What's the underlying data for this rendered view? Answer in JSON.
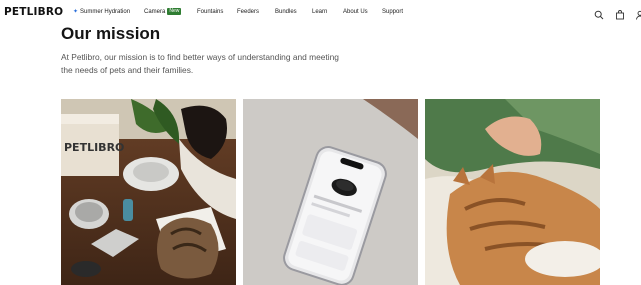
{
  "brand": {
    "logo_text": "PETLIBRO"
  },
  "nav": {
    "items": [
      {
        "label": "Summer Hydration",
        "icon": "sparkle-icon"
      },
      {
        "label": "Camera",
        "badge": "New"
      },
      {
        "label": "Fountains"
      },
      {
        "label": "Feeders"
      },
      {
        "label": "Bundles"
      },
      {
        "label": "Learn"
      },
      {
        "label": "About Us"
      },
      {
        "label": "Support"
      }
    ],
    "actions": [
      "search-icon",
      "bag-icon",
      "account-icon"
    ]
  },
  "mission": {
    "title": "Our mission",
    "description": "At Petlibro, our mission is to find better ways of understanding and meeting the needs of pets and their families."
  },
  "colors": {
    "badge": "#2f7d32",
    "sparkle": "#2a6fdb",
    "text": "#1d1d1d",
    "muted": "#555555"
  }
}
